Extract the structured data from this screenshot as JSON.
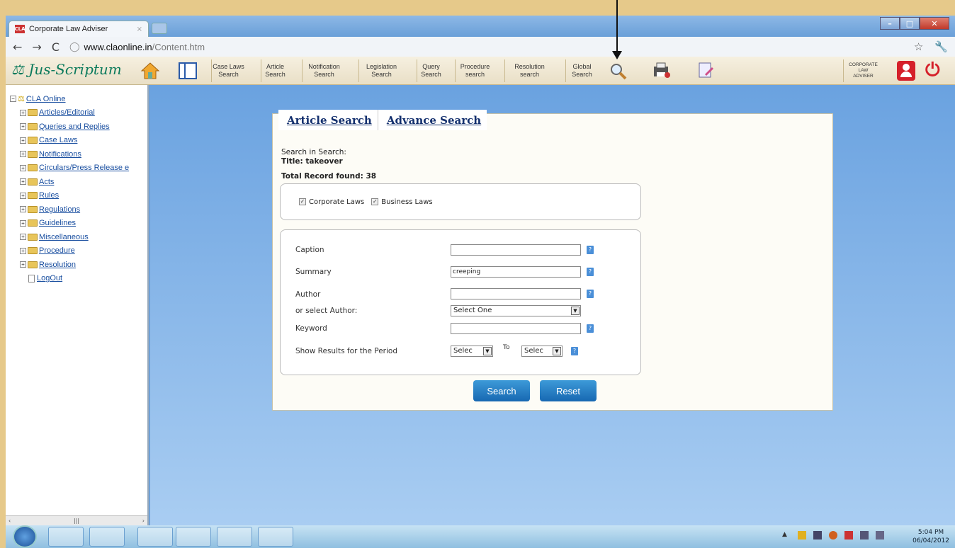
{
  "browser": {
    "tab_title": "Corporate Law Adviser",
    "tab_close": "×",
    "url_host": "www.claonline.in",
    "url_path": "/Content.htm",
    "favicon_text": "CLA"
  },
  "toolbar": {
    "logo": "Jus-Scriptum",
    "buttons": [
      {
        "line1": "Case Laws",
        "line2": "Search"
      },
      {
        "line1": "Article",
        "line2": "Search"
      },
      {
        "line1": "Notification",
        "line2": "Search"
      },
      {
        "line1": "Legislation",
        "line2": "Search"
      },
      {
        "line1": "Query",
        "line2": "Search"
      },
      {
        "line1": "Procedure",
        "line2": "search"
      },
      {
        "line1": "Resolution",
        "line2": "search"
      },
      {
        "line1": "Global",
        "line2": "Search"
      }
    ],
    "brand_line1": "CORPORATE",
    "brand_line2": "LAW",
    "brand_line3": "ADVISER"
  },
  "sidebar": {
    "root": "CLA Online",
    "items": [
      "Articles/Editorial",
      "Queries and Replies",
      "Case Laws",
      "Notifications",
      "Circulars/Press Release e",
      "Acts",
      "Rules",
      "Regulations",
      "Guidelines",
      "Miscellaneous",
      "Procedure",
      "Resolution"
    ],
    "logout": "LogOut"
  },
  "search": {
    "tab_article": "Article Search",
    "tab_advance": "Advance Search",
    "search_in_label": "Search in Search:",
    "search_in_value": "Title: takeover",
    "total_records": "Total Record found: 38",
    "cb_corporate": "Corporate Laws",
    "cb_business": "Business Laws",
    "caption_label": "Caption",
    "caption_value": "",
    "summary_label": "Summary",
    "summary_value": "creeping",
    "author_label": "Author",
    "author_value": "",
    "select_author_label": "or select Author:",
    "select_author_value": "Select One",
    "keyword_label": "Keyword",
    "keyword_value": "",
    "period_label": "Show Results for the Period",
    "period_from": "Selec",
    "period_to_label": "To",
    "period_to": "Selec",
    "search_button": "Search",
    "reset_button": "Reset"
  },
  "taskbar": {
    "time": "5:04 PM",
    "date": "06/04/2012"
  }
}
